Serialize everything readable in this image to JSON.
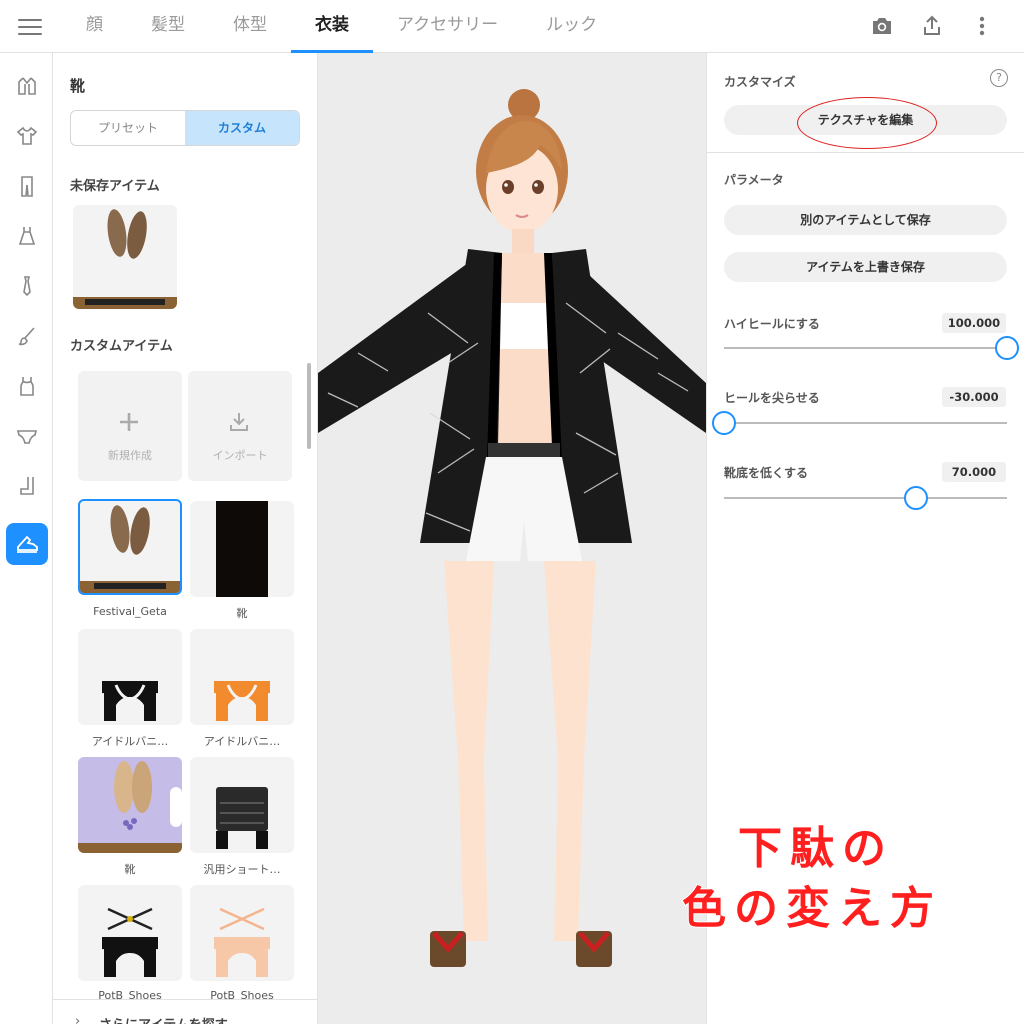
{
  "tabs": [
    "顔",
    "髪型",
    "体型",
    "衣装",
    "アクセサリー",
    "ルック"
  ],
  "active_tab_index": 3,
  "top_icons": [
    "camera-icon",
    "share-icon",
    "more-vertical-icon"
  ],
  "rail_icons": [
    "outerwear-icon",
    "shirt-icon",
    "pants-icon",
    "onepiece-icon",
    "necktie-icon",
    "brush-icon",
    "tanktop-icon",
    "underwear-icon",
    "socks-icon",
    "shoes-icon"
  ],
  "rail_active_index": 9,
  "left_panel": {
    "title": "靴",
    "segments": [
      "プリセット",
      "カスタム"
    ],
    "active_segment": 1,
    "unsaved_title": "未保存アイテム",
    "custom_title": "カスタムアイテム",
    "new_label": "新規作成",
    "import_label": "インポート",
    "items": [
      {
        "label": "Festival_Geta"
      },
      {
        "label": "靴"
      },
      {
        "label": "アイドルバニ…"
      },
      {
        "label": "アイドルバニ…"
      },
      {
        "label": "靴"
      },
      {
        "label": "汎用ショート…"
      },
      {
        "label": "PotB_Shoes"
      },
      {
        "label": "PotB_Shoes"
      }
    ],
    "more_label": "さらにアイテムを探す"
  },
  "right_panel": {
    "customize_label": "カスタマイズ",
    "help_symbol": "?",
    "edit_texture": "テクスチャを編集",
    "params_label": "パラメータ",
    "save_as_new": "別のアイテムとして保存",
    "overwrite_save": "アイテムを上書き保存",
    "sliders": [
      {
        "label": "ハイヒールにする",
        "value_text": "100.000",
        "fraction": 1.0
      },
      {
        "label": "ヒールを尖らせる",
        "value_text": "-30.000",
        "fraction": 0.0
      },
      {
        "label": "靴底を低くする",
        "value_text": "70.000",
        "fraction": 0.68
      }
    ]
  },
  "overlay": {
    "line1": "下駄の",
    "line2": "色の変え方"
  },
  "colors": {
    "accent": "#1e90ff",
    "annotation_red": "#ff1f1f",
    "selected_segment_bg": "#c6e4fb"
  }
}
